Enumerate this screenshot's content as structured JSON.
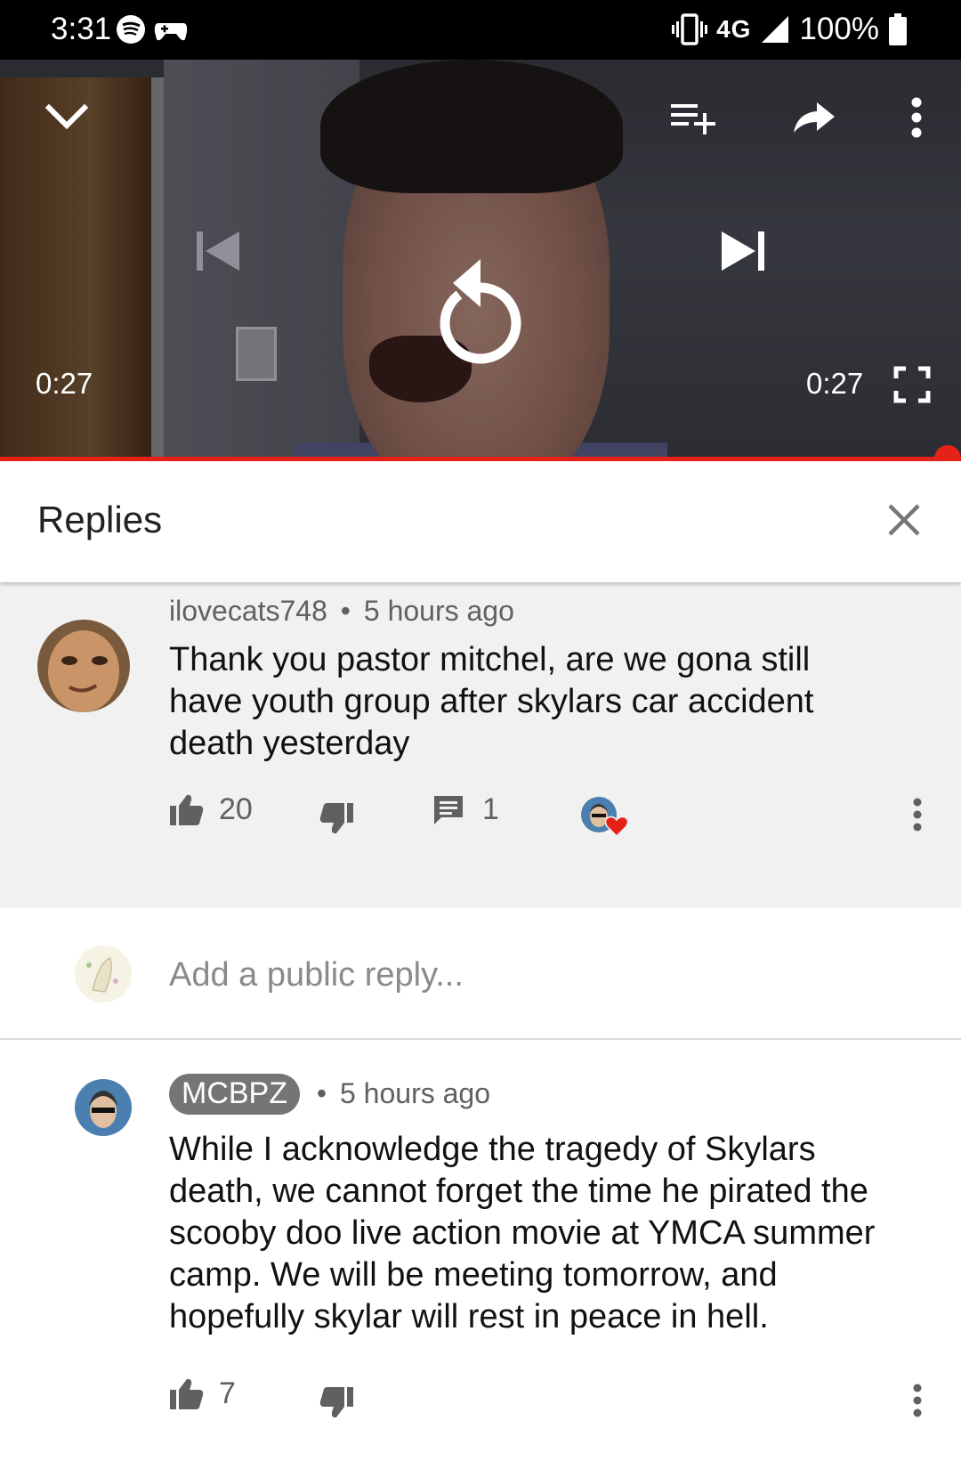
{
  "status_bar": {
    "time": "3:31",
    "network": "4G",
    "battery": "100%",
    "icons": [
      "spotify-icon",
      "gamepad-icon",
      "vibrate-icon",
      "signal-icon",
      "battery-icon"
    ]
  },
  "player": {
    "current_time": "0:27",
    "duration": "0:27",
    "progress": 1.0,
    "accent_color": "#e62117",
    "icons": [
      "chevron-down-icon",
      "add-to-playlist-icon",
      "share-icon",
      "more-vert-icon",
      "previous-icon",
      "replay-icon",
      "next-icon",
      "fullscreen-icon"
    ]
  },
  "replies_panel": {
    "title": "Replies"
  },
  "parent_comment": {
    "author": "ilovecats748",
    "separator": "•",
    "age": "5 hours ago",
    "text_lines": [
      "Thank you pastor mitchel, are we gona still",
      "have youth group after skylars car accident",
      "death yesterday"
    ],
    "likes": "20",
    "replies": "1",
    "hearted": true
  },
  "add_reply": {
    "placeholder": "Add a public reply..."
  },
  "reply": {
    "author": "MCBPZ",
    "separator": "•",
    "age": "5 hours ago",
    "text_lines": [
      "While I acknowledge the tragedy of Skylars",
      "death, we cannot forget the time he pirated the",
      "scooby doo live action movie at YMCA summer",
      "camp. We will be meeting tomorrow, and",
      "hopefully skylar will rest in peace in hell."
    ],
    "likes": "7"
  }
}
